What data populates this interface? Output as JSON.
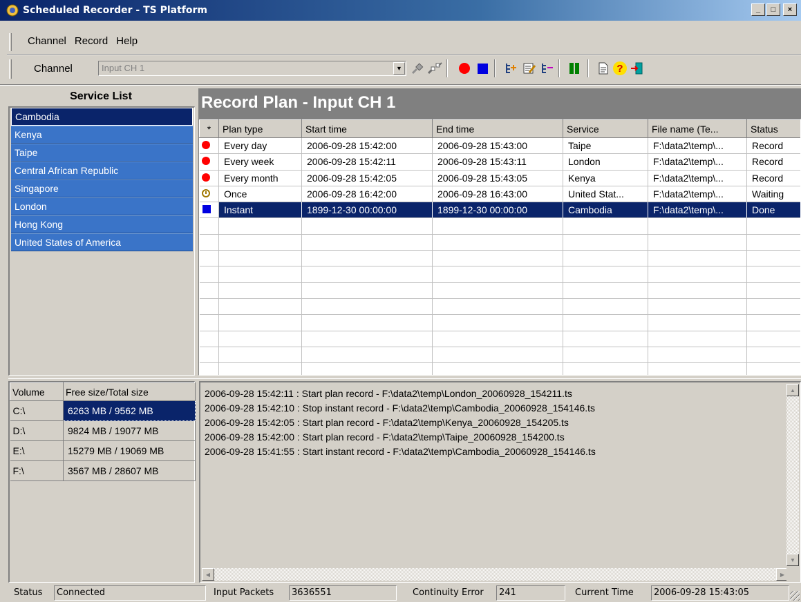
{
  "window": {
    "title": "Scheduled Recorder - TS Platform",
    "minimize": "_",
    "maximize": "□",
    "close": "×"
  },
  "menu": [
    "Channel",
    "Record",
    "Help"
  ],
  "toolbar": {
    "channel_label": "Channel",
    "channel_value": "Input CH 1",
    "icons": [
      "plug-connect-icon",
      "plug-disconnect-icon",
      "record-icon",
      "stop-icon",
      "add-plan-icon",
      "edit-plan-icon",
      "delete-plan-icon",
      "pause-icon",
      "log-icon",
      "help-icon",
      "exit-icon"
    ]
  },
  "service_list": {
    "title": "Service List",
    "items": [
      "Cambodia",
      "Kenya",
      "Taipe",
      "Central African Republic",
      "Singapore",
      "London",
      "Hong Kong",
      "United States of America"
    ],
    "selected": 0
  },
  "record_plan": {
    "title": "Record Plan - Input CH 1",
    "columns": [
      "*",
      "Plan type",
      "Start time",
      "End time",
      "Service",
      "File name (Te...",
      "Status"
    ],
    "rows": [
      {
        "mark": "red-dot",
        "plan_type": "Every day",
        "start": "2006-09-28 15:42:00",
        "end": "2006-09-28 15:43:00",
        "service": "Taipe",
        "file": "F:\\data2\\temp\\...",
        "status": "Record"
      },
      {
        "mark": "red-dot",
        "plan_type": "Every week",
        "start": "2006-09-28 15:42:11",
        "end": "2006-09-28 15:43:11",
        "service": "London",
        "file": "F:\\data2\\temp\\...",
        "status": "Record"
      },
      {
        "mark": "red-dot",
        "plan_type": "Every month",
        "start": "2006-09-28 15:42:05",
        "end": "2006-09-28 15:43:05",
        "service": "Kenya",
        "file": "F:\\data2\\temp\\...",
        "status": "Record"
      },
      {
        "mark": "clock",
        "plan_type": "Once",
        "start": "2006-09-28 16:42:00",
        "end": "2006-09-28 16:43:00",
        "service": "United Stat...",
        "file": "F:\\data2\\temp\\...",
        "status": "Waiting"
      },
      {
        "mark": "blue-square",
        "plan_type": "Instant",
        "start": "1899-12-30 00:00:00",
        "end": "1899-12-30 00:00:00",
        "service": "Cambodia",
        "file": "F:\\data2\\temp\\...",
        "status": "Done"
      }
    ],
    "selected": 4
  },
  "volumes": {
    "columns": [
      "Volume",
      "Free size/Total size"
    ],
    "rows": [
      {
        "volume": "C:\\",
        "size": "6263 MB / 9562 MB"
      },
      {
        "volume": "D:\\",
        "size": "9824 MB / 19077 MB"
      },
      {
        "volume": "E:\\",
        "size": "15279 MB / 19069 MB"
      },
      {
        "volume": "F:\\",
        "size": "3567 MB / 28607 MB"
      }
    ],
    "selected": 0
  },
  "log": [
    "2006-09-28 15:42:11 : Start plan record - F:\\data2\\temp\\London_20060928_154211.ts",
    "2006-09-28 15:42:10 : Stop instant record - F:\\data2\\temp\\Cambodia_20060928_154146.ts",
    "2006-09-28 15:42:05 : Start plan record - F:\\data2\\temp\\Kenya_20060928_154205.ts",
    "2006-09-28 15:42:00 : Start plan record - F:\\data2\\temp\\Taipe_20060928_154200.ts",
    "2006-09-28 15:41:55 : Start instant record - F:\\data2\\temp\\Cambodia_20060928_154146.ts"
  ],
  "statusbar": {
    "status_label": "Status",
    "status_value": "Connected",
    "packets_label": "Input Packets",
    "packets_value": "3636551",
    "cc_label": "Continuity Error",
    "cc_value": "241",
    "time_label": "Current Time",
    "time_value": "2006-09-28 15:43:05"
  }
}
